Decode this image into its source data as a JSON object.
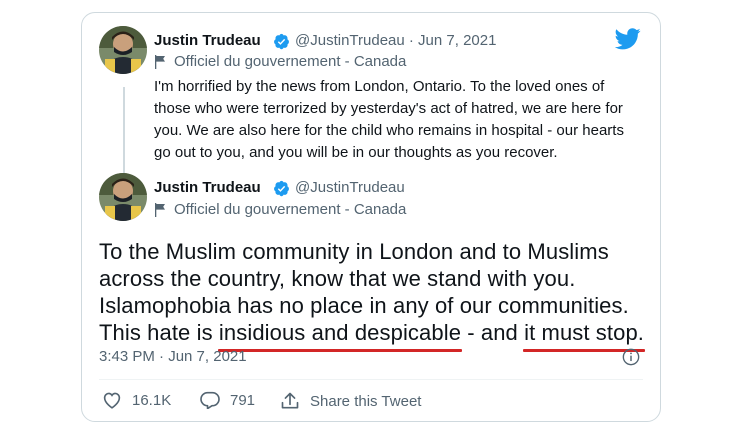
{
  "reply_tweet": {
    "author_name": "Justin Trudeau",
    "handle_date": "@JustinTrudeau · Jun 7, 2021",
    "affiliation": "Officiel du gouvernement - Canada",
    "text": "I'm horrified by the news from London, Ontario. To the loved ones of those who were terrorized by yesterday's act of hatred, we are here for you. We are also here for the child who remains in hospital - our hearts go out to you, and you will be in our thoughts as you recover."
  },
  "main_tweet": {
    "author_name": "Justin Trudeau",
    "handle": "@JustinTrudeau",
    "affiliation": "Officiel du gouvernement - Canada",
    "text_part1": "To the Muslim community in London and to Muslims across the country, know that we stand with you. Islamophobia has no place in any of our communities. This hate is ",
    "text_underlined1": "insidious and despicable",
    "text_part2": " - and ",
    "text_underlined2": "it must stop.",
    "timestamp": "3:43 PM · Jun 7, 2021"
  },
  "actions": {
    "likes": "16.1K",
    "replies": "791",
    "share_label": "Share this Tweet"
  },
  "icons": {
    "brand": "twitter-bird-icon",
    "verified": "verified-badge-icon",
    "flag": "flag-icon",
    "info": "info-icon",
    "like": "heart-icon",
    "reply": "reply-bubble-icon",
    "share": "share-icon"
  },
  "colors": {
    "twitter_blue": "#1d9bf0",
    "underline_red": "#d32626",
    "secondary_text": "#536471"
  }
}
